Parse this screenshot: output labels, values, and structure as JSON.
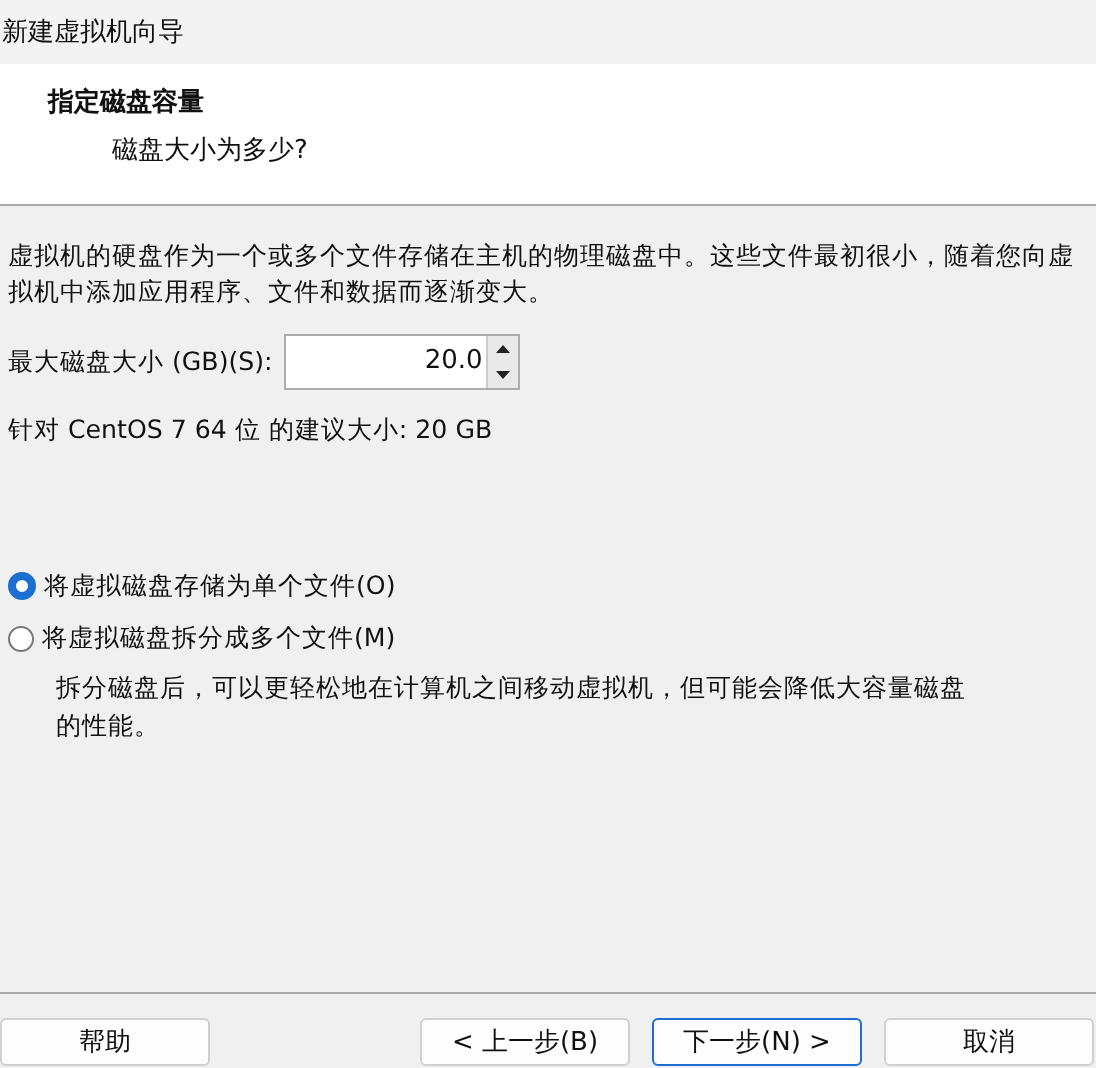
{
  "window": {
    "title": "新建虚拟机向导"
  },
  "header": {
    "title": "指定磁盘容量",
    "subtitle": "磁盘大小为多少?"
  },
  "description": "虚拟机的硬盘作为一个或多个文件存储在主机的物理磁盘中。这些文件最初很小，随着您向虚拟机中添加应用程序、文件和数据而逐渐变大。",
  "disk_size": {
    "label": "最大磁盘大小 (GB)(S):",
    "value": "20.0"
  },
  "recommendation": "针对 CentOS 7 64 位 的建议大小: 20 GB",
  "storage_options": [
    {
      "label": "将虚拟磁盘存储为单个文件(O)",
      "selected": true
    },
    {
      "label": "将虚拟磁盘拆分成多个文件(M)",
      "selected": false
    }
  ],
  "split_note": "拆分磁盘后，可以更轻松地在计算机之间移动虚拟机，但可能会降低大容量磁盘的性能。",
  "buttons": [
    {
      "label": "帮助",
      "default": false
    },
    {
      "label": "< 上一步(B)",
      "default": false
    },
    {
      "label": "下一步(N) >",
      "default": true
    },
    {
      "label": "取消",
      "default": false
    }
  ]
}
